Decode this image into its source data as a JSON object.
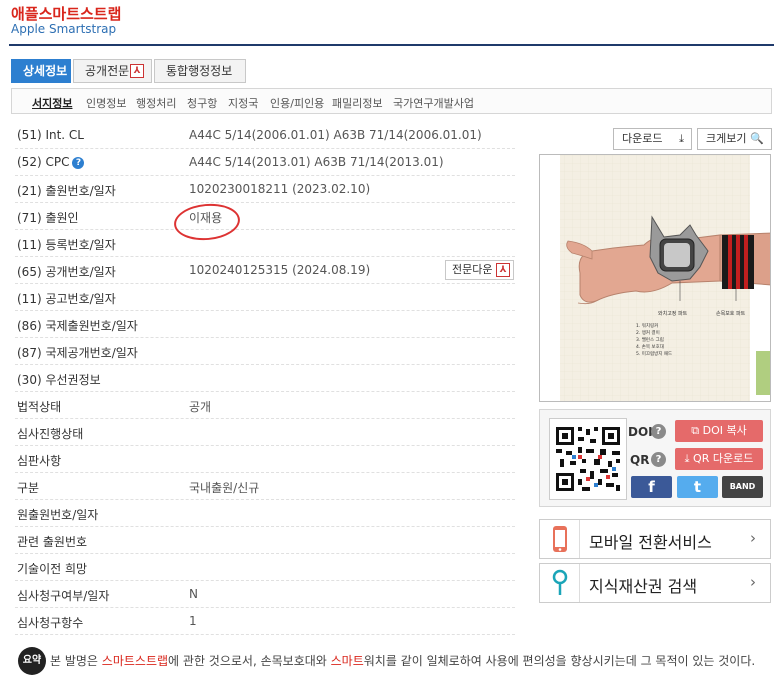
{
  "header": {
    "title": "애플스마트스트랩",
    "subtitle": "Apple Smartstrap"
  },
  "main_tabs": [
    {
      "label": "상세정보"
    },
    {
      "label": "공개전문"
    },
    {
      "label": "통합행정정보"
    }
  ],
  "sub_tabs": [
    "서지정보",
    "인명정보",
    "행정처리",
    "청구항",
    "지정국",
    "인용/피인용",
    "패밀리정보",
    "국가연구개발사업"
  ],
  "biblio": [
    {
      "label": "(51) Int. CL",
      "value": "A44C 5/14(2006.01.01) A63B 71/14(2006.01.01)"
    },
    {
      "label": "(52) CPC",
      "value": "A44C 5/14(2013.01) A63B 71/14(2013.01)"
    },
    {
      "label": "(21) 출원번호/일자",
      "value": "1020230018211 (2023.02.10)"
    },
    {
      "label": "(71) 출원인",
      "value": "이재용"
    },
    {
      "label": "(11) 등록번호/일자",
      "value": ""
    },
    {
      "label": "(65) 공개번호/일자",
      "value": "1020240125315 (2024.08.19)"
    },
    {
      "label": "(11) 공고번호/일자",
      "value": ""
    },
    {
      "label": "(86) 국제출원번호/일자",
      "value": ""
    },
    {
      "label": "(87) 국제공개번호/일자",
      "value": ""
    },
    {
      "label": "(30) 우선권정보",
      "value": ""
    },
    {
      "label": "법적상태",
      "value": "공개"
    },
    {
      "label": "심사진행상태",
      "value": ""
    },
    {
      "label": "심판사항",
      "value": ""
    },
    {
      "label": "구분",
      "value": "국내출원/신규"
    },
    {
      "label": "원출원번호/일자",
      "value": ""
    },
    {
      "label": "관련 출원번호",
      "value": ""
    },
    {
      "label": "기술이전 희망",
      "value": ""
    },
    {
      "label": "심사청구여부/일자",
      "value": "N"
    },
    {
      "label": "심사청구항수",
      "value": "1"
    }
  ],
  "cpc_help_icon": "?",
  "fulltext_download_label": "전문다운",
  "pdf_icon": "pdf-icon",
  "buttons": {
    "download": "다운로드",
    "zoom": "크게보기"
  },
  "patent_image": {
    "labels": [
      "와치고정 파트",
      "손목보호 파트"
    ],
    "legend": [
      "1. 워치링커",
      "2. 앵커 결이",
      "3. 밸런스 그립",
      "4. 손목 보호대",
      "5. 미끄럼방지 패드"
    ]
  },
  "share": {
    "doi_label": "DOI",
    "qr_label": "QR",
    "doi_copy": "DOI 복사",
    "qr_download": "QR 다운로드",
    "social": [
      "f",
      "t",
      "BAND"
    ]
  },
  "services": [
    {
      "label": "모바일 전환서비스",
      "icon": "mobile-phone-icon"
    },
    {
      "label": "지식재산권 검색",
      "icon": "search-pin-icon"
    }
  ],
  "summary": {
    "badge": "요약",
    "parts": [
      "본 발명은 ",
      "스마트스트랩",
      "에 관한 것으로서, 손목보호대와 ",
      "스마트",
      "워치를 같이 일체로하여 사용에 편의성을 향상시키는데 그 목적이 있는 것이다."
    ]
  },
  "colors": {
    "accent": "#2d7fd0",
    "title_red": "#d9261c",
    "annotation_red": "#d33"
  }
}
